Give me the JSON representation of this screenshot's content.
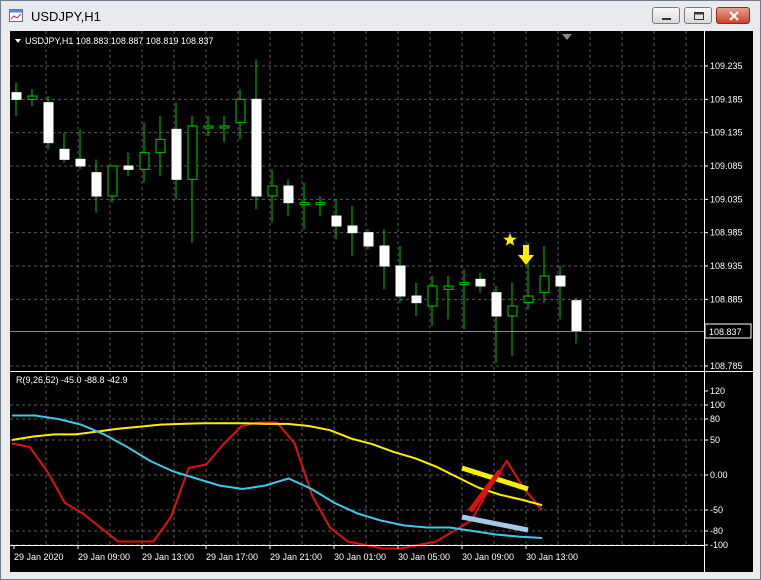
{
  "window": {
    "title": "USDJPY,H1"
  },
  "price_panel": {
    "header": "USDJPY,H1  108.883 108.887 108.819 108.837",
    "current_price": "108.837",
    "y_ticks": [
      "109.235",
      "109.185",
      "109.135",
      "109.085",
      "109.035",
      "108.985",
      "108.935",
      "108.885",
      "108.785"
    ],
    "candle_up_color": "#00cc00",
    "candle_body_color": "#ffffff",
    "markers": {
      "star_color": "#ffee00",
      "arrow_color": "#ffee00"
    }
  },
  "indicator_panel": {
    "header": "R(9,26,52) -45.0 -88.8 -42.9",
    "y_ticks": [
      "120",
      "100",
      "80",
      "50",
      "0.00",
      "-50",
      "-80",
      "-100"
    ],
    "series_colors": {
      "red": "#e01010",
      "yellow": "#ffee00",
      "cyan": "#40c8e8",
      "light_blue": "#a8c8e8"
    }
  },
  "x_axis": {
    "labels": [
      "29 Jan 2020",
      "29 Jan 09:00",
      "29 Jan 13:00",
      "29 Jan 17:00",
      "29 Jan 21:00",
      "30 Jan 01:00",
      "30 Jan 05:00",
      "30 Jan 09:00",
      "30 Jan 13:00"
    ]
  },
  "chart_data": {
    "type": "candlestick",
    "ylim": [
      108.785,
      109.285
    ],
    "candles": [
      {
        "o": 109.195,
        "h": 109.21,
        "l": 109.16,
        "c": 109.185
      },
      {
        "o": 109.185,
        "h": 109.2,
        "l": 109.175,
        "c": 109.19
      },
      {
        "o": 109.18,
        "h": 109.19,
        "l": 109.11,
        "c": 109.12
      },
      {
        "o": 109.11,
        "h": 109.135,
        "l": 109.09,
        "c": 109.095
      },
      {
        "o": 109.095,
        "h": 109.14,
        "l": 109.08,
        "c": 109.085
      },
      {
        "o": 109.075,
        "h": 109.095,
        "l": 109.015,
        "c": 109.04
      },
      {
        "o": 109.04,
        "h": 109.075,
        "l": 109.03,
        "c": 109.085
      },
      {
        "o": 109.085,
        "h": 109.105,
        "l": 109.07,
        "c": 109.08
      },
      {
        "o": 109.08,
        "h": 109.15,
        "l": 109.06,
        "c": 109.105
      },
      {
        "o": 109.105,
        "h": 109.16,
        "l": 109.07,
        "c": 109.125
      },
      {
        "o": 109.14,
        "h": 109.18,
        "l": 109.035,
        "c": 109.065
      },
      {
        "o": 109.065,
        "h": 109.16,
        "l": 108.97,
        "c": 109.145
      },
      {
        "o": 109.145,
        "h": 109.16,
        "l": 109.13,
        "c": 109.145
      },
      {
        "o": 109.145,
        "h": 109.16,
        "l": 109.12,
        "c": 109.145
      },
      {
        "o": 109.15,
        "h": 109.2,
        "l": 109.125,
        "c": 109.185
      },
      {
        "o": 109.185,
        "h": 109.245,
        "l": 109.02,
        "c": 109.04
      },
      {
        "o": 109.04,
        "h": 109.08,
        "l": 109.0,
        "c": 109.055
      },
      {
        "o": 109.055,
        "h": 109.065,
        "l": 109.01,
        "c": 109.03
      },
      {
        "o": 109.03,
        "h": 109.06,
        "l": 108.99,
        "c": 109.03
      },
      {
        "o": 109.03,
        "h": 109.04,
        "l": 109.01,
        "c": 109.03
      },
      {
        "o": 109.01,
        "h": 109.035,
        "l": 108.975,
        "c": 108.995
      },
      {
        "o": 108.995,
        "h": 109.025,
        "l": 108.95,
        "c": 108.985
      },
      {
        "o": 108.985,
        "h": 108.99,
        "l": 108.96,
        "c": 108.965
      },
      {
        "o": 108.965,
        "h": 108.99,
        "l": 108.9,
        "c": 108.935
      },
      {
        "o": 108.935,
        "h": 108.965,
        "l": 108.88,
        "c": 108.89
      },
      {
        "o": 108.89,
        "h": 108.91,
        "l": 108.86,
        "c": 108.88
      },
      {
        "o": 108.875,
        "h": 108.92,
        "l": 108.845,
        "c": 108.905
      },
      {
        "o": 108.9,
        "h": 108.92,
        "l": 108.855,
        "c": 108.905
      },
      {
        "o": 108.91,
        "h": 108.93,
        "l": 108.84,
        "c": 108.91
      },
      {
        "o": 108.915,
        "h": 108.925,
        "l": 108.895,
        "c": 108.905
      },
      {
        "o": 108.895,
        "h": 108.905,
        "l": 108.79,
        "c": 108.86
      },
      {
        "o": 108.86,
        "h": 108.91,
        "l": 108.8,
        "c": 108.875
      },
      {
        "o": 108.88,
        "h": 108.97,
        "l": 108.87,
        "c": 108.89
      },
      {
        "o": 108.895,
        "h": 108.965,
        "l": 108.88,
        "c": 108.92
      },
      {
        "o": 108.92,
        "h": 108.935,
        "l": 108.855,
        "c": 108.905
      },
      {
        "o": 108.883,
        "h": 108.887,
        "l": 108.819,
        "c": 108.837
      }
    ],
    "oscillator": {
      "ylim": [
        -110,
        120
      ],
      "series": [
        {
          "color": "red",
          "values": [
            45,
            40,
            5,
            -40,
            -55,
            -75,
            -95,
            -95,
            -95,
            -60,
            10,
            15,
            45,
            70,
            75,
            75,
            45,
            -30,
            -75,
            -95,
            -100,
            -105,
            -105,
            -100,
            -95,
            -80,
            -65,
            -20,
            20,
            -20,
            -50
          ]
        },
        {
          "color": "yellow",
          "values": [
            50,
            55,
            58,
            58,
            62,
            66,
            69,
            72,
            73,
            74,
            74,
            74,
            73,
            73,
            70,
            64,
            52,
            44,
            33,
            24,
            12,
            -3,
            -18,
            -28,
            -35,
            -43
          ]
        },
        {
          "color": "cyan",
          "values": [
            85,
            85,
            80,
            72,
            58,
            40,
            20,
            5,
            -5,
            -15,
            -20,
            -15,
            -5,
            -20,
            -40,
            -55,
            -65,
            -72,
            -75,
            -75,
            -80,
            -85,
            -88,
            -90
          ]
        }
      ]
    }
  }
}
